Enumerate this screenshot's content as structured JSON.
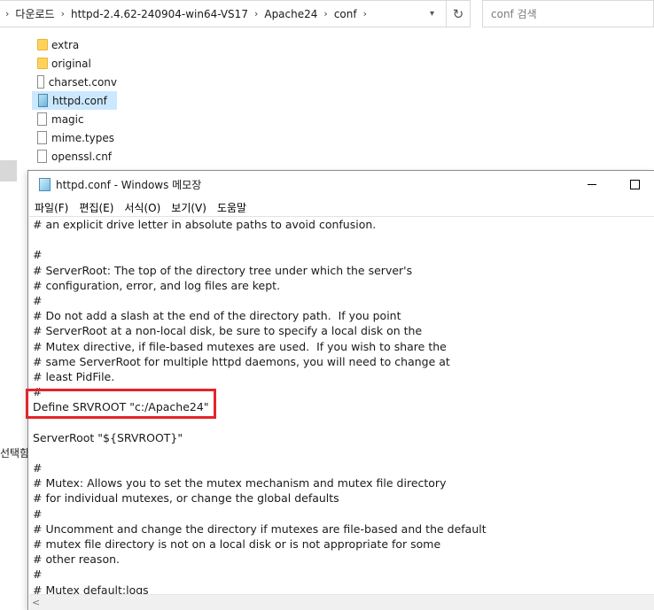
{
  "explorer": {
    "breadcrumbs": [
      "다운로드",
      "httpd-2.4.62-240904-win64-VS17",
      "Apache24",
      "conf"
    ],
    "search_placeholder": "conf 검색",
    "files": [
      {
        "name": "extra",
        "kind": "folder"
      },
      {
        "name": "original",
        "kind": "folder"
      },
      {
        "name": "charset.conv",
        "kind": "file"
      },
      {
        "name": "httpd.conf",
        "kind": "notepad-file",
        "selected": true
      },
      {
        "name": "magic",
        "kind": "file"
      },
      {
        "name": "mime.types",
        "kind": "file"
      },
      {
        "name": "openssl.cnf",
        "kind": "file"
      }
    ],
    "status_partial": "선택함"
  },
  "notepad": {
    "title": "httpd.conf - Windows 메모장",
    "menu": [
      "파일(F)",
      "편집(E)",
      "서식(O)",
      "보기(V)",
      "도움말"
    ],
    "lines": [
      "# an explicit drive letter in absolute paths to avoid confusion.",
      "",
      "#",
      "# ServerRoot: The top of the directory tree under which the server's",
      "# configuration, error, and log files are kept.",
      "#",
      "# Do not add a slash at the end of the directory path.  If you point",
      "# ServerRoot at a non-local disk, be sure to specify a local disk on the",
      "# Mutex directive, if file-based mutexes are used.  If you wish to share the",
      "# same ServerRoot for multiple httpd daemons, you will need to change at",
      "# least PidFile.",
      "#",
      "Define SRVROOT \"c:/Apache24\"",
      "",
      "ServerRoot \"${SRVROOT}\"",
      "",
      "#",
      "# Mutex: Allows you to set the mutex mechanism and mutex file directory",
      "# for individual mutexes, or change the global defaults",
      "#",
      "# Uncomment and change the directory if mutexes are file-based and the default",
      "# mutex file directory is not on a local disk or is not appropriate for some",
      "# other reason.",
      "#",
      "# Mutex default:logs"
    ]
  },
  "icons": {
    "folder": "folder-icon",
    "file": "file-icon",
    "notepad": "notepad-icon",
    "refresh": "refresh-icon",
    "chevron": "chevron-right-icon"
  },
  "colors": {
    "highlight": "#e3242b",
    "selection": "#cce8ff"
  }
}
